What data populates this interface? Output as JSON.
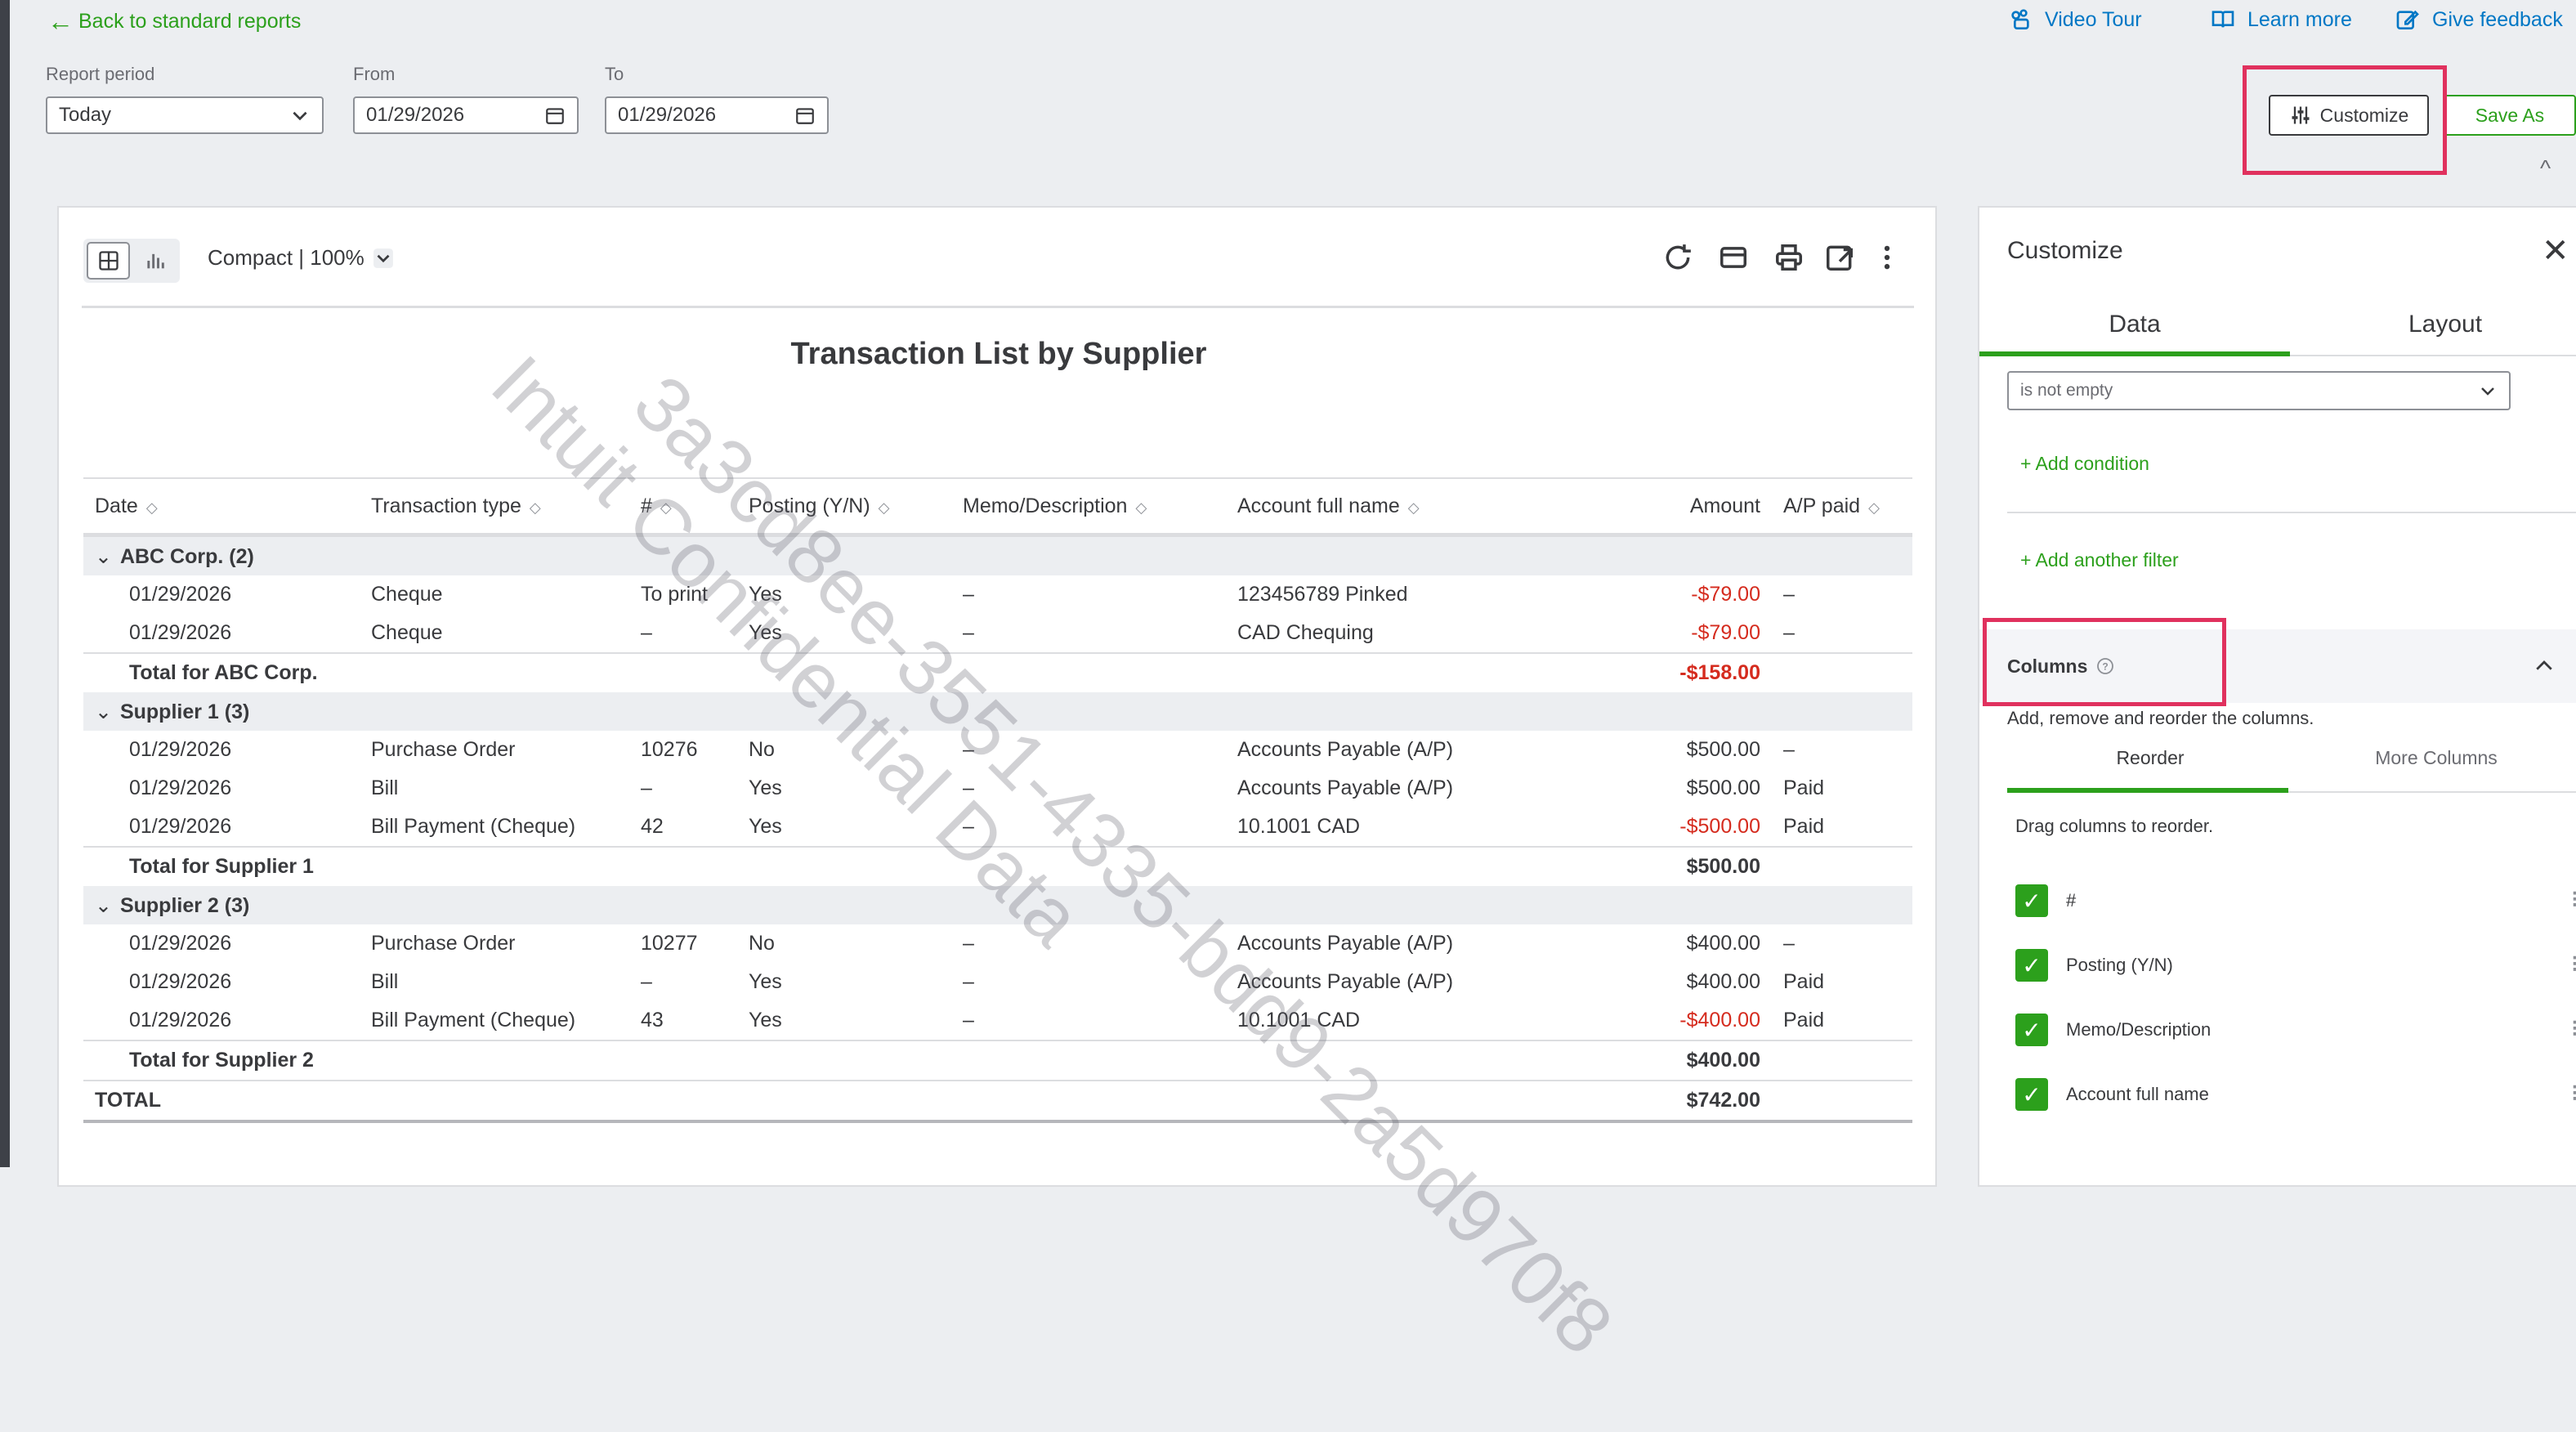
{
  "top": {
    "back_label": "Back to standard reports",
    "video_tour": "Video Tour",
    "learn_more": "Learn more",
    "give_feedback": "Give feedback"
  },
  "filters": {
    "report_period_label": "Report period",
    "report_period_value": "Today",
    "from_label": "From",
    "from_value": "01/29/2026",
    "to_label": "To",
    "to_value": "01/29/2026"
  },
  "actions": {
    "customize_label": "Customize",
    "save_as_label": "Save As"
  },
  "report": {
    "view_label": "Compact | 100%",
    "title": "Transaction List by Supplier",
    "columns": [
      "Date",
      "Transaction type",
      "#",
      "Posting (Y/N)",
      "Memo/Description",
      "Account full name",
      "Amount",
      "A/P paid"
    ],
    "rows": [
      {
        "kind": "group",
        "label": "ABC Corp. (2)"
      },
      {
        "kind": "data",
        "cells": [
          "01/29/2026",
          "Cheque",
          "To print",
          "Yes",
          "–",
          "123456789 Pinked",
          "-$79.00",
          "–"
        ],
        "neg": true
      },
      {
        "kind": "data",
        "cells": [
          "01/29/2026",
          "Cheque",
          "–",
          "Yes",
          "–",
          "CAD Chequing",
          "-$79.00",
          "–"
        ],
        "neg": true
      },
      {
        "kind": "total",
        "label": "Total for ABC Corp.",
        "amount": "-$158.00",
        "neg": true
      },
      {
        "kind": "group",
        "label": "Supplier 1 (3)"
      },
      {
        "kind": "data",
        "cells": [
          "01/29/2026",
          "Purchase Order",
          "10276",
          "No",
          "–",
          "Accounts Payable (A/P)",
          "$500.00",
          "–"
        ],
        "neg": false
      },
      {
        "kind": "data",
        "cells": [
          "01/29/2026",
          "Bill",
          "–",
          "Yes",
          "–",
          "Accounts Payable (A/P)",
          "$500.00",
          "Paid"
        ],
        "neg": false
      },
      {
        "kind": "data",
        "cells": [
          "01/29/2026",
          "Bill Payment (Cheque)",
          "42",
          "Yes",
          "–",
          "10.1001 CAD",
          "-$500.00",
          "Paid"
        ],
        "neg": true
      },
      {
        "kind": "total",
        "label": "Total for Supplier 1",
        "amount": "$500.00",
        "neg": false
      },
      {
        "kind": "group",
        "label": "Supplier 2 (3)"
      },
      {
        "kind": "data",
        "cells": [
          "01/29/2026",
          "Purchase Order",
          "10277",
          "No",
          "–",
          "Accounts Payable (A/P)",
          "$400.00",
          "–"
        ],
        "neg": false
      },
      {
        "kind": "data",
        "cells": [
          "01/29/2026",
          "Bill",
          "–",
          "Yes",
          "–",
          "Accounts Payable (A/P)",
          "$400.00",
          "Paid"
        ],
        "neg": false
      },
      {
        "kind": "data",
        "cells": [
          "01/29/2026",
          "Bill Payment (Cheque)",
          "43",
          "Yes",
          "–",
          "10.1001 CAD",
          "-$400.00",
          "Paid"
        ],
        "neg": true
      },
      {
        "kind": "total",
        "label": "Total for Supplier 2",
        "amount": "$400.00",
        "neg": false
      },
      {
        "kind": "grand",
        "label": "TOTAL",
        "amount": "$742.00",
        "neg": false
      }
    ]
  },
  "customize_panel": {
    "title": "Customize",
    "tab_data": "Data",
    "tab_layout": "Layout",
    "filter_value": "is not empty",
    "add_condition": "+ Add condition",
    "add_another_filter": "+ Add another filter",
    "columns_title": "Columns",
    "columns_desc": "Add, remove and reorder the columns.",
    "sub_tab_reorder": "Reorder",
    "sub_tab_more": "More Columns",
    "drag_hint": "Drag columns to reorder.",
    "column_items": [
      "#",
      "Posting (Y/N)",
      "Memo/Description",
      "Account full name"
    ]
  },
  "watermark": {
    "line1": "3a3cd8ee-3551-4335-bdd9-2a5d970f8",
    "line2": "Intuit Confidential Data"
  },
  "colors": {
    "accent": "#2ca01c",
    "link": "#0077c5",
    "negative": "#d52b1e",
    "highlight": "#e0315e"
  }
}
